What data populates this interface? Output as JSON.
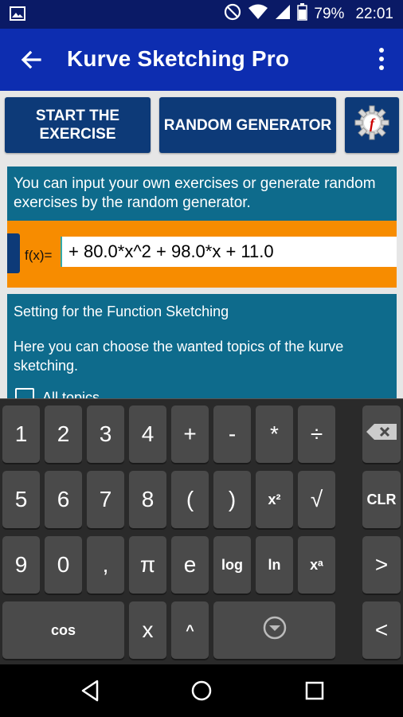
{
  "status_bar": {
    "battery": "79%",
    "time": "22:01",
    "icons": [
      "image-icon",
      "dnd-icon",
      "wifi-icon",
      "signal-icon",
      "battery-icon"
    ]
  },
  "app_bar": {
    "title": "Kurve Sketching Pro",
    "icons": [
      "back-arrow-icon",
      "overflow-menu-icon"
    ]
  },
  "buttons": {
    "start_line1": "START THE",
    "start_line2": "EXERCISE",
    "random": "RANDOM GENERATOR",
    "settings_icon": "function-gear-icon"
  },
  "info_text": "You can input your own exercises or generate random exercises by the random generator.",
  "input": {
    "label": "f(x)=",
    "value": "+ 80.0*x^2 + 98.0*x + 11.0"
  },
  "settings": {
    "title": "Setting for the Function Sketching",
    "description": "Here you can choose the wanted topics of the kurve sketching.",
    "all_topics_label": "All topics"
  },
  "keyboard": {
    "row1": [
      "1",
      "2",
      "3",
      "4",
      "+",
      "-",
      "*",
      "÷"
    ],
    "row2": [
      "5",
      "6",
      "7",
      "8",
      "(",
      ")",
      "x²",
      "√",
      "CLR"
    ],
    "row3": [
      "9",
      "0",
      ",",
      "π",
      "e",
      "log",
      "ln",
      "xᵃ",
      ">"
    ],
    "row4": [
      "cos",
      "x",
      "^",
      "<"
    ],
    "icons": [
      "backspace-icon",
      "hide-keyboard-icon"
    ]
  },
  "colors": {
    "app_bar": "#0d2db0",
    "status_bar": "#0a1a66",
    "button": "#0d3a78",
    "panel": "#0e6b8c",
    "input_strip": "#f78c00",
    "key": "#4a4a4a"
  }
}
